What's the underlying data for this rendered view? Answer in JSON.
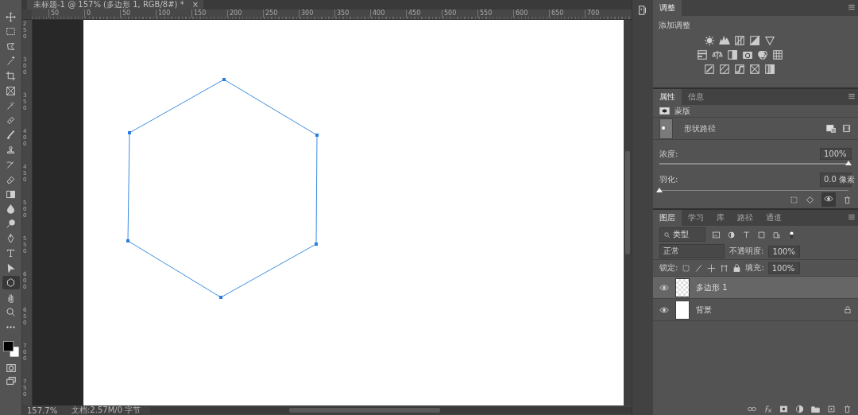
{
  "document": {
    "title": "未标题-1 @ 157% (多边形 1, RGB/8#) *",
    "close": "×",
    "zoom": "157.7%",
    "info": "文档:2.57M/0 字节",
    "ruler_h": [
      "50",
      "0",
      "50",
      "100",
      "150",
      "200",
      "250",
      "300",
      "350",
      "400",
      "450",
      "500",
      "550",
      "600",
      "650",
      "700"
    ],
    "ruler_v": [
      "250",
      "300",
      "350",
      "400",
      "450",
      "500",
      "550",
      "600",
      "650",
      "700",
      "750"
    ]
  },
  "tools": [
    {
      "kind": "move",
      "selected": false
    },
    {
      "kind": "marquee",
      "selected": false
    },
    {
      "kind": "lasso",
      "selected": false
    },
    {
      "kind": "wand",
      "selected": false
    },
    {
      "kind": "crop",
      "selected": false
    },
    {
      "kind": "frame",
      "selected": false
    },
    {
      "kind": "eyedropper",
      "selected": false
    },
    {
      "kind": "bandage",
      "selected": false
    },
    {
      "kind": "brush",
      "selected": false
    },
    {
      "kind": "stamp",
      "selected": false
    },
    {
      "kind": "history",
      "selected": false
    },
    {
      "kind": "eraser",
      "selected": false
    },
    {
      "kind": "gradient",
      "selected": false
    },
    {
      "kind": "drop",
      "selected": false
    },
    {
      "kind": "dodge",
      "selected": false
    },
    {
      "kind": "pen",
      "selected": false
    },
    {
      "kind": "type",
      "selected": false
    },
    {
      "kind": "pointer",
      "selected": false
    },
    {
      "kind": "polygon",
      "selected": true
    },
    {
      "kind": "hand",
      "selected": false
    },
    {
      "kind": "zoom",
      "selected": false
    },
    {
      "kind": "more",
      "selected": false
    }
  ],
  "adjustments": {
    "tab": "调整",
    "label": "添加调整"
  },
  "properties": {
    "tabs": [
      {
        "label": "属性",
        "selected": true
      },
      {
        "label": "信息",
        "selected": false
      }
    ],
    "mask": "蒙版",
    "path": "形状路径",
    "density": {
      "label": "浓度:",
      "value": "100%",
      "level": 1
    },
    "feather": {
      "label": "羽化:",
      "value": "0.0 像素",
      "level": 0
    }
  },
  "layers_panel": {
    "tabs": [
      {
        "label": "图层",
        "selected": true
      },
      {
        "label": "学习",
        "selected": false
      },
      {
        "label": "库",
        "selected": false
      },
      {
        "label": "路径",
        "selected": false
      },
      {
        "label": "通道",
        "selected": false
      }
    ],
    "filter": "类型",
    "blend": "正常",
    "opacity_label": "不透明度:",
    "opacity": "100%",
    "lock_label": "锁定:",
    "fill_label": "填充:",
    "fill": "100%",
    "layers": [
      {
        "name": "多边形 1",
        "kind": "shape",
        "visible": true,
        "selected": true,
        "locked": false
      },
      {
        "name": "背景",
        "kind": "background",
        "visible": true,
        "selected": false,
        "locked": true
      }
    ]
  }
}
